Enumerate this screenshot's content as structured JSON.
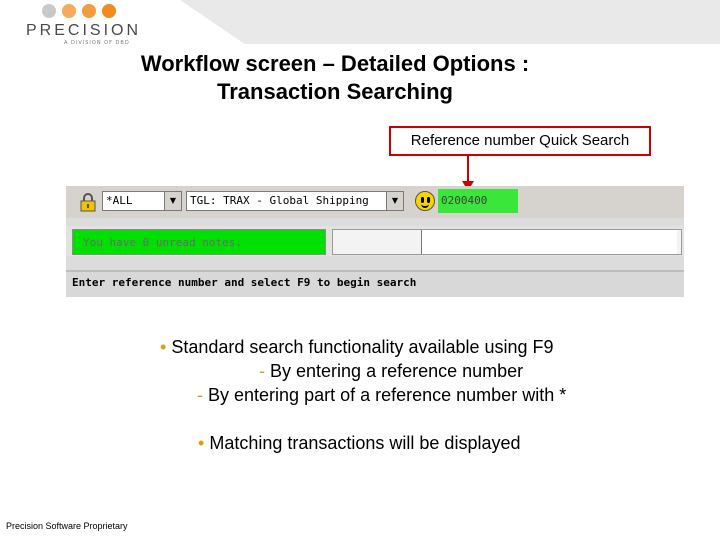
{
  "brand": {
    "logo_word": "PRECISION",
    "logo_subtitle": "A DIVISION OF DBD",
    "dot_colors": [
      "#c9c9c9",
      "#f7a95c",
      "#f39b3d",
      "#f28a1c"
    ]
  },
  "slide": {
    "title_line1": "Workflow screen – Detailed Options :",
    "title_line2": "Transaction Searching",
    "callout_label": "Reference number Quick Search",
    "footer": "Precision Software Proprietary"
  },
  "app": {
    "filter_value": "*ALL",
    "queue_value": "TGL: TRAX - Global Shipping",
    "reference_value": "0200400",
    "notes_text": "You have 0 unread notes.",
    "status_text": "Enter reference number and select F9 to begin search",
    "icons": {
      "lock": "lock-icon",
      "smiley": "smiley-icon",
      "dropdown": "chevron-down-icon"
    }
  },
  "bullets": {
    "main": "Standard search functionality available using F9",
    "sub1": "By entering a reference number",
    "sub2": "By entering part of a reference number with *",
    "second": "Matching transactions will be displayed",
    "marker": "•",
    "dash": "-"
  },
  "colors": {
    "callout_border": "#cc0000",
    "highlight_green": "#39e639",
    "notes_green": "#00e000",
    "bullet_accent": "#d7a11a"
  }
}
